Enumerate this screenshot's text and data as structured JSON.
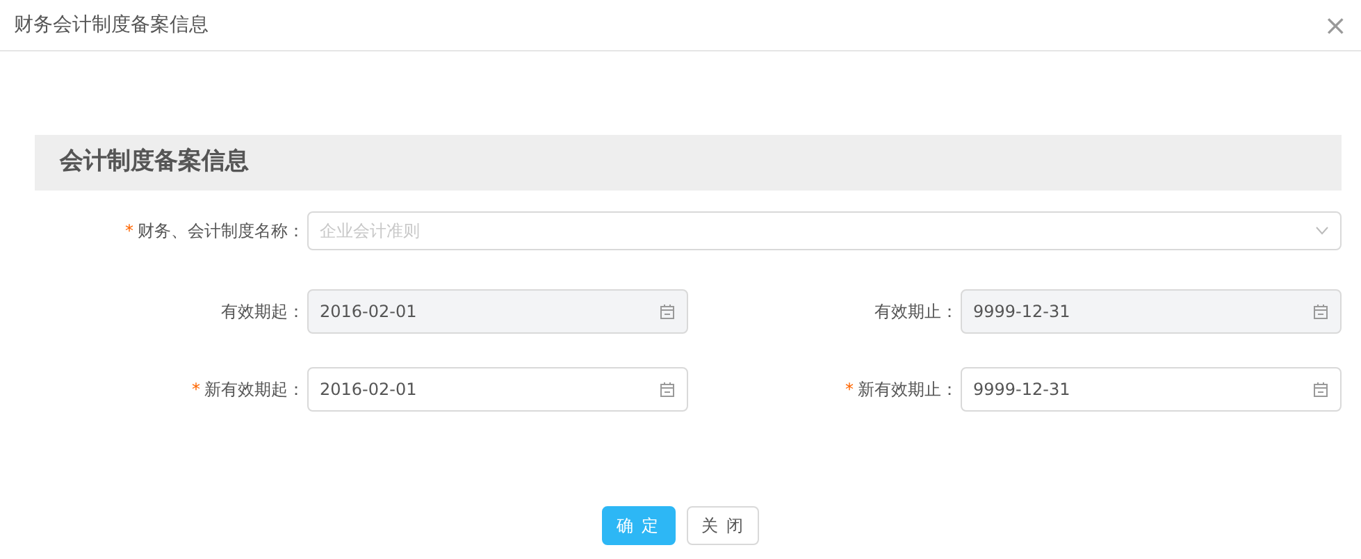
{
  "window": {
    "title": "财务会计制度备案信息",
    "close": "×"
  },
  "section": {
    "title": "会计制度备案信息"
  },
  "rows": [
    [
      {
        "label": "财务、会计制度名称：",
        "marker": "*",
        "kind": "select",
        "placeholder": "企业会计准则",
        "disabled": false
      }
    ],
    [
      {
        "label": "有效期起：",
        "kind": "date",
        "value": "2016-02-01",
        "disabled": true
      },
      {
        "label": "有效期止：",
        "kind": "date",
        "value": "9999-12-31",
        "disabled": true
      }
    ],
    [
      {
        "label": "新有效期起：",
        "marker": "*",
        "kind": "date",
        "value": "2016-02-01",
        "disabled": false
      },
      {
        "label": "新有效期止：",
        "marker": "*",
        "kind": "date",
        "value": "9999-12-31",
        "disabled": false
      }
    ]
  ],
  "buttons": [
    {
      "label": "确 定",
      "kind": "primary"
    },
    {
      "label": "关 闭",
      "kind": "default"
    }
  ]
}
